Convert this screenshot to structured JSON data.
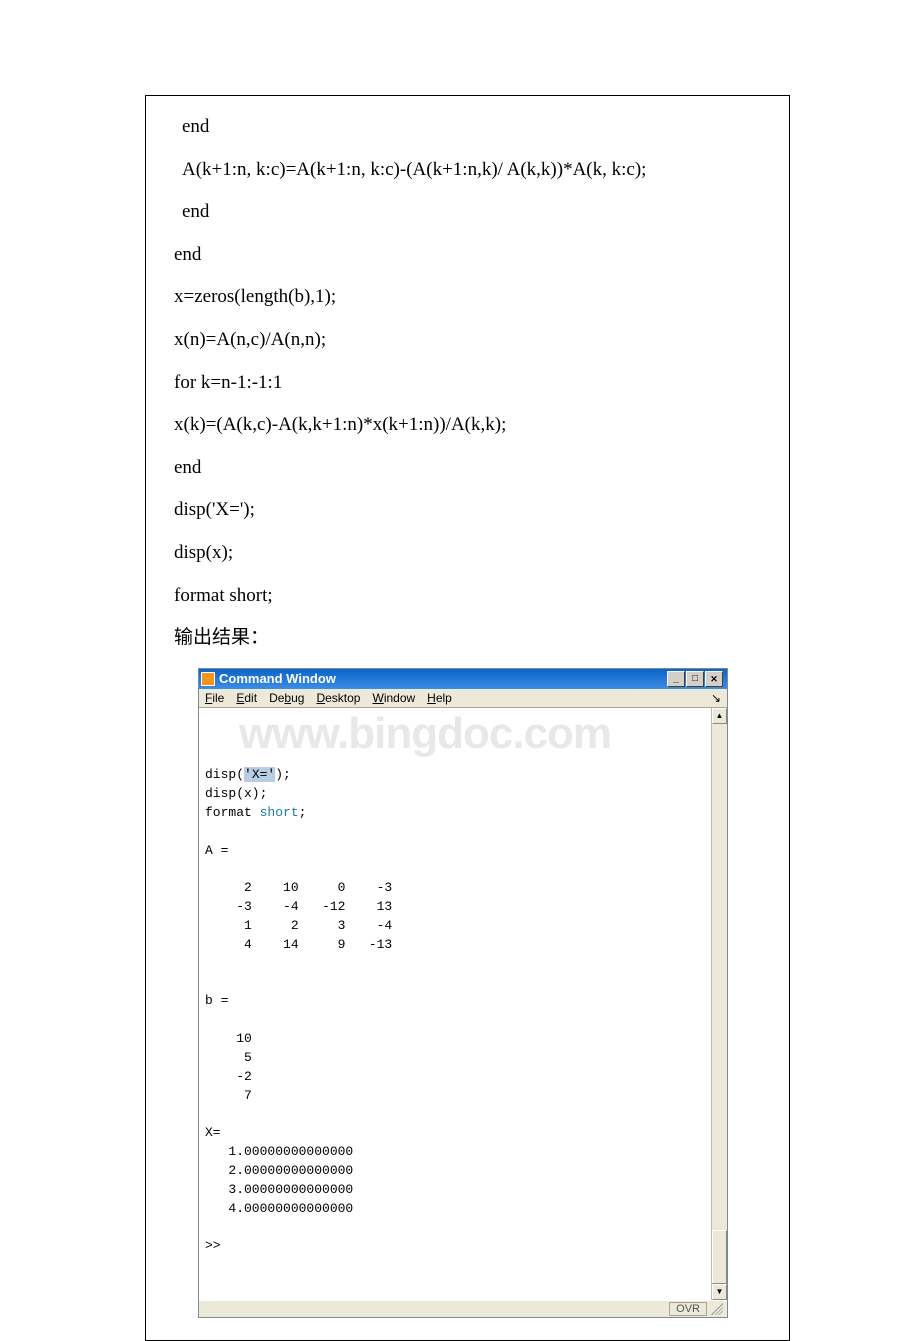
{
  "code_lines": [
    " end",
    " A(k+1:n, k:c)=A(k+1:n, k:c)-(A(k+1:n,k)/ A(k,k))*A(k, k:c);",
    " end",
    "end",
    "x=zeros(length(b),1);",
    "x(n)=A(n,c)/A(n,n);",
    "for k=n-1:-1:1",
    " x(k)=(A(k,c)-A(k,k+1:n)*x(k+1:n))/A(k,k);",
    "end",
    "disp('X=');",
    "disp(x);",
    "format short;",
    "输出结果："
  ],
  "cmd": {
    "title": "Command Window",
    "menus": [
      "File",
      "Edit",
      "Debug",
      "Desktop",
      "Window",
      "Help"
    ],
    "status": "OVR",
    "body_lines": [
      {
        "t": "disp(",
        "seg": [
          {
            "cls": "hl",
            "txt": "'X='"
          }
        ],
        "tail": ");"
      },
      {
        "t": "disp(x);"
      },
      {
        "t": "format ",
        "seg": [
          {
            "cls": "kw-short",
            "txt": "short"
          }
        ],
        "tail": ";"
      },
      {
        "t": ""
      },
      {
        "t": "A ="
      },
      {
        "t": ""
      },
      {
        "t": "     2    10     0    -3"
      },
      {
        "t": "    -3    -4   -12    13"
      },
      {
        "t": "     1     2     3    -4"
      },
      {
        "t": "     4    14     9   -13"
      },
      {
        "t": ""
      },
      {
        "t": ""
      },
      {
        "t": "b ="
      },
      {
        "t": ""
      },
      {
        "t": "    10"
      },
      {
        "t": "     5"
      },
      {
        "t": "    -2"
      },
      {
        "t": "     7"
      },
      {
        "t": ""
      },
      {
        "t": "X="
      },
      {
        "t": "   1.00000000000000"
      },
      {
        "t": "   2.00000000000000"
      },
      {
        "t": "   3.00000000000000"
      },
      {
        "t": "   4.00000000000000"
      },
      {
        "t": ""
      },
      {
        "t": ">> "
      }
    ],
    "watermark": "www.bingdoc.com"
  }
}
